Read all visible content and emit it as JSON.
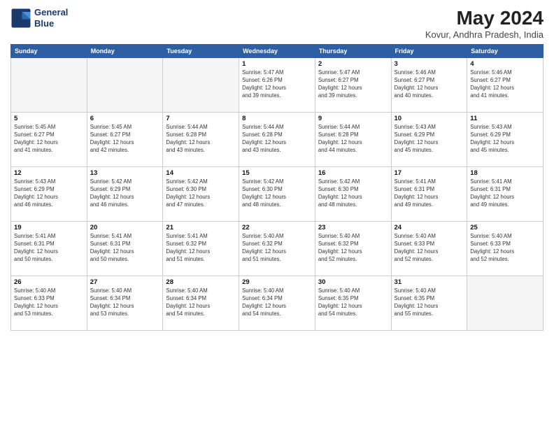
{
  "logo": {
    "line1": "General",
    "line2": "Blue"
  },
  "title": "May 2024",
  "subtitle": "Kovur, Andhra Pradesh, India",
  "days_of_week": [
    "Sunday",
    "Monday",
    "Tuesday",
    "Wednesday",
    "Thursday",
    "Friday",
    "Saturday"
  ],
  "weeks": [
    [
      {
        "day": "",
        "info": ""
      },
      {
        "day": "",
        "info": ""
      },
      {
        "day": "",
        "info": ""
      },
      {
        "day": "1",
        "info": "Sunrise: 5:47 AM\nSunset: 6:26 PM\nDaylight: 12 hours\nand 39 minutes."
      },
      {
        "day": "2",
        "info": "Sunrise: 5:47 AM\nSunset: 6:27 PM\nDaylight: 12 hours\nand 39 minutes."
      },
      {
        "day": "3",
        "info": "Sunrise: 5:46 AM\nSunset: 6:27 PM\nDaylight: 12 hours\nand 40 minutes."
      },
      {
        "day": "4",
        "info": "Sunrise: 5:46 AM\nSunset: 6:27 PM\nDaylight: 12 hours\nand 41 minutes."
      }
    ],
    [
      {
        "day": "5",
        "info": "Sunrise: 5:45 AM\nSunset: 6:27 PM\nDaylight: 12 hours\nand 41 minutes."
      },
      {
        "day": "6",
        "info": "Sunrise: 5:45 AM\nSunset: 6:27 PM\nDaylight: 12 hours\nand 42 minutes."
      },
      {
        "day": "7",
        "info": "Sunrise: 5:44 AM\nSunset: 6:28 PM\nDaylight: 12 hours\nand 43 minutes."
      },
      {
        "day": "8",
        "info": "Sunrise: 5:44 AM\nSunset: 6:28 PM\nDaylight: 12 hours\nand 43 minutes."
      },
      {
        "day": "9",
        "info": "Sunrise: 5:44 AM\nSunset: 6:28 PM\nDaylight: 12 hours\nand 44 minutes."
      },
      {
        "day": "10",
        "info": "Sunrise: 5:43 AM\nSunset: 6:29 PM\nDaylight: 12 hours\nand 45 minutes."
      },
      {
        "day": "11",
        "info": "Sunrise: 5:43 AM\nSunset: 6:29 PM\nDaylight: 12 hours\nand 45 minutes."
      }
    ],
    [
      {
        "day": "12",
        "info": "Sunrise: 5:43 AM\nSunset: 6:29 PM\nDaylight: 12 hours\nand 46 minutes."
      },
      {
        "day": "13",
        "info": "Sunrise: 5:42 AM\nSunset: 6:29 PM\nDaylight: 12 hours\nand 46 minutes."
      },
      {
        "day": "14",
        "info": "Sunrise: 5:42 AM\nSunset: 6:30 PM\nDaylight: 12 hours\nand 47 minutes."
      },
      {
        "day": "15",
        "info": "Sunrise: 5:42 AM\nSunset: 6:30 PM\nDaylight: 12 hours\nand 48 minutes."
      },
      {
        "day": "16",
        "info": "Sunrise: 5:42 AM\nSunset: 6:30 PM\nDaylight: 12 hours\nand 48 minutes."
      },
      {
        "day": "17",
        "info": "Sunrise: 5:41 AM\nSunset: 6:31 PM\nDaylight: 12 hours\nand 49 minutes."
      },
      {
        "day": "18",
        "info": "Sunrise: 5:41 AM\nSunset: 6:31 PM\nDaylight: 12 hours\nand 49 minutes."
      }
    ],
    [
      {
        "day": "19",
        "info": "Sunrise: 5:41 AM\nSunset: 6:31 PM\nDaylight: 12 hours\nand 50 minutes."
      },
      {
        "day": "20",
        "info": "Sunrise: 5:41 AM\nSunset: 6:31 PM\nDaylight: 12 hours\nand 50 minutes."
      },
      {
        "day": "21",
        "info": "Sunrise: 5:41 AM\nSunset: 6:32 PM\nDaylight: 12 hours\nand 51 minutes."
      },
      {
        "day": "22",
        "info": "Sunrise: 5:40 AM\nSunset: 6:32 PM\nDaylight: 12 hours\nand 51 minutes."
      },
      {
        "day": "23",
        "info": "Sunrise: 5:40 AM\nSunset: 6:32 PM\nDaylight: 12 hours\nand 52 minutes."
      },
      {
        "day": "24",
        "info": "Sunrise: 5:40 AM\nSunset: 6:33 PM\nDaylight: 12 hours\nand 52 minutes."
      },
      {
        "day": "25",
        "info": "Sunrise: 5:40 AM\nSunset: 6:33 PM\nDaylight: 12 hours\nand 52 minutes."
      }
    ],
    [
      {
        "day": "26",
        "info": "Sunrise: 5:40 AM\nSunset: 6:33 PM\nDaylight: 12 hours\nand 53 minutes."
      },
      {
        "day": "27",
        "info": "Sunrise: 5:40 AM\nSunset: 6:34 PM\nDaylight: 12 hours\nand 53 minutes."
      },
      {
        "day": "28",
        "info": "Sunrise: 5:40 AM\nSunset: 6:34 PM\nDaylight: 12 hours\nand 54 minutes."
      },
      {
        "day": "29",
        "info": "Sunrise: 5:40 AM\nSunset: 6:34 PM\nDaylight: 12 hours\nand 54 minutes."
      },
      {
        "day": "30",
        "info": "Sunrise: 5:40 AM\nSunset: 6:35 PM\nDaylight: 12 hours\nand 54 minutes."
      },
      {
        "day": "31",
        "info": "Sunrise: 5:40 AM\nSunset: 6:35 PM\nDaylight: 12 hours\nand 55 minutes."
      },
      {
        "day": "",
        "info": ""
      }
    ]
  ]
}
